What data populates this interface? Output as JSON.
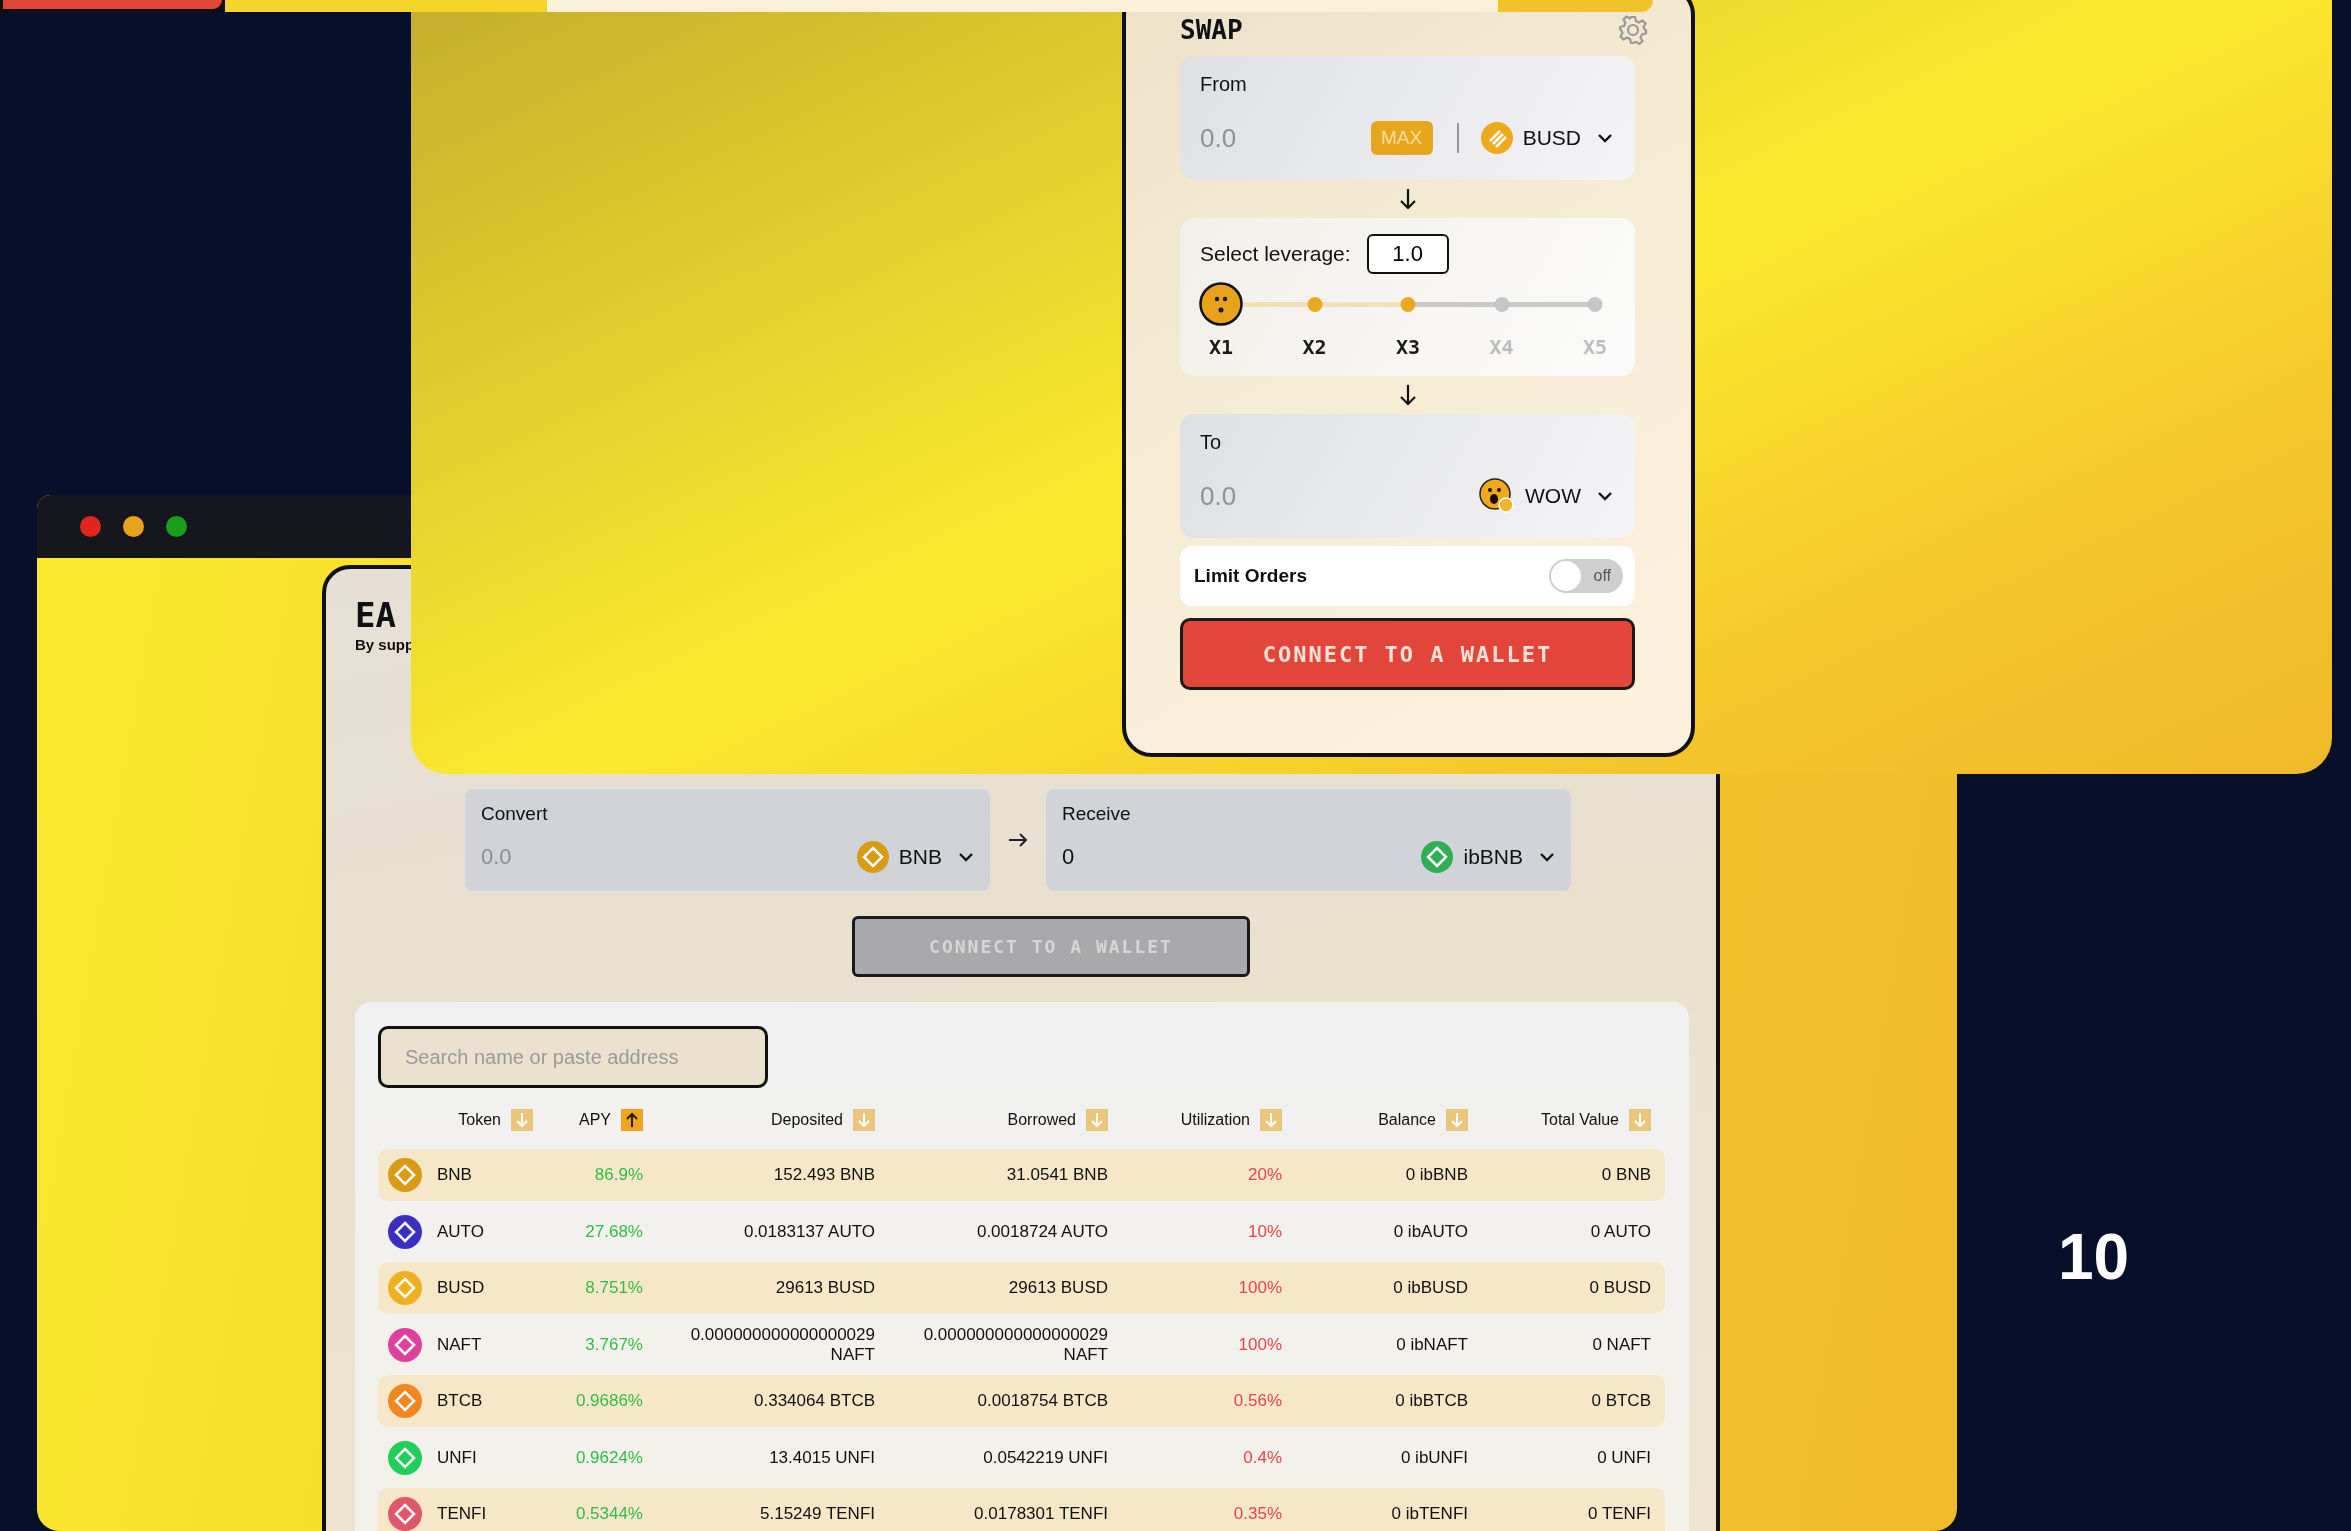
{
  "earn_window": {
    "app_title": "EA",
    "app_subtitle": "By supp",
    "convert": {
      "label": "Convert",
      "placeholder": "0.0",
      "token": "BNB"
    },
    "receive": {
      "label": "Receive",
      "value": "0",
      "token": "ibBNB"
    },
    "connect_button": {
      "label": "CONNECT TO A WALLET",
      "disabled": true
    },
    "search": {
      "placeholder": "Search name or paste address"
    },
    "table": {
      "columns": [
        {
          "label": "Token",
          "ascending": false,
          "selected": false
        },
        {
          "label": "APY",
          "ascending": true,
          "selected": true
        },
        {
          "label": "Deposited",
          "ascending": false,
          "selected": false
        },
        {
          "label": "Borrowed",
          "ascending": false,
          "selected": false
        },
        {
          "label": "Utilization",
          "ascending": false,
          "selected": false
        },
        {
          "label": "Balance",
          "ascending": false,
          "selected": false
        },
        {
          "label": "Total Value",
          "ascending": false,
          "selected": false
        }
      ],
      "rows": [
        {
          "token": "BNB",
          "color": "#d99a14",
          "apy": "86.9%",
          "deposited": "152.493 BNB",
          "borrowed": "31.0541 BNB",
          "utilization": "20%",
          "balance": "0 ibBNB",
          "total_value": "0 BNB"
        },
        {
          "token": "AUTO",
          "color": "#3a2fc2",
          "apy": "27.68%",
          "deposited": "0.0183137 AUTO",
          "borrowed": "0.0018724 AUTO",
          "utilization": "10%",
          "balance": "0 ibAUTO",
          "total_value": "0 AUTO"
        },
        {
          "token": "BUSD",
          "color": "#f0b020",
          "apy": "8.751%",
          "deposited": "29613 BUSD",
          "borrowed": "29613 BUSD",
          "utilization": "100%",
          "balance": "0 ibBUSD",
          "total_value": "0 BUSD"
        },
        {
          "token": "NAFT",
          "color": "#e0409c",
          "apy": "3.767%",
          "deposited": "0.000000000000000029 NAFT",
          "borrowed": "0.000000000000000029 NAFT",
          "utilization": "100%",
          "balance": "0 ibNAFT",
          "total_value": "0 NAFT"
        },
        {
          "token": "BTCB",
          "color": "#f3861f",
          "apy": "0.9686%",
          "deposited": "0.334064 BTCB",
          "borrowed": "0.0018754 BTCB",
          "utilization": "0.56%",
          "balance": "0 ibBTCB",
          "total_value": "0 BTCB"
        },
        {
          "token": "UNFI",
          "color": "#1fcf5a",
          "apy": "0.9624%",
          "deposited": "13.4015 UNFI",
          "borrowed": "0.0542219 UNFI",
          "utilization": "0.4%",
          "balance": "0 ibUNFI",
          "total_value": "0 UNFI"
        },
        {
          "token": "TENFI",
          "color": "#e0566a",
          "apy": "0.5344%",
          "deposited": "5.15249 TENFI",
          "borrowed": "0.0178301 TENFI",
          "utilization": "0.35%",
          "balance": "0 ibTENFI",
          "total_value": "0 TENFI"
        }
      ]
    }
  },
  "swap_window": {
    "title": "SWAP",
    "from": {
      "label": "From",
      "placeholder": "0.0",
      "max_label": "MAX",
      "token": "BUSD"
    },
    "leverage": {
      "label": "Select leverage:",
      "value": "1.0",
      "steps": [
        {
          "label": "X1",
          "selected": true,
          "reached": true
        },
        {
          "label": "X2",
          "selected": false,
          "reached": true
        },
        {
          "label": "X3",
          "selected": false,
          "reached": true
        },
        {
          "label": "X4",
          "selected": false,
          "reached": false
        },
        {
          "label": "X5",
          "selected": false,
          "reached": false
        }
      ]
    },
    "to": {
      "label": "To",
      "placeholder": "0.0",
      "token": "WOW"
    },
    "limit_orders": {
      "label": "Limit Orders",
      "on": false,
      "state_label": "off"
    },
    "connect_button": {
      "label": "CONNECT TO A WALLET",
      "disabled": false
    }
  },
  "page_number": "10"
}
